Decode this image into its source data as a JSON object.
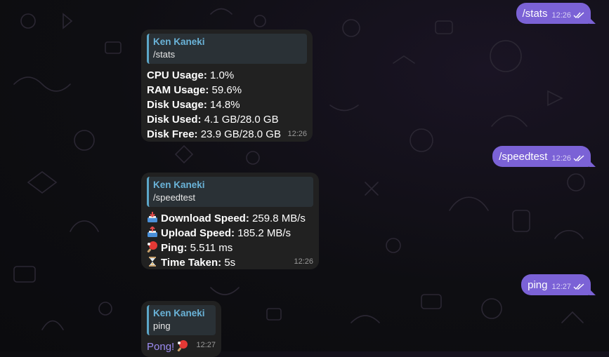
{
  "chat": {
    "outgoing": [
      {
        "text": "/stats",
        "time": "12:26",
        "status": "read"
      },
      {
        "text": "/speedtest",
        "time": "12:26",
        "status": "read"
      },
      {
        "text": "ping",
        "time": "12:27",
        "status": "read"
      }
    ],
    "stats_reply": {
      "reply_to_name": "Ken Kaneki",
      "reply_to_text": "/stats",
      "lines": [
        {
          "label": "CPU Usage:",
          "value": "1.0%"
        },
        {
          "label": "RAM Usage:",
          "value": "59.6%"
        },
        {
          "label": "Disk Usage:",
          "value": "14.8%"
        },
        {
          "label": "Disk Used:",
          "value": "4.1 GB/28.0 GB"
        },
        {
          "label": "Disk Free:",
          "value": "23.9 GB/28.0 GB"
        }
      ],
      "time": "12:26"
    },
    "speedtest_reply": {
      "reply_to_name": "Ken Kaneki",
      "reply_to_text": "/speedtest",
      "lines": [
        {
          "icon": "inbox-tray-icon",
          "label": "Download Speed:",
          "value": "259.8 MB/s"
        },
        {
          "icon": "outbox-tray-icon",
          "label": "Upload Speed:",
          "value": "185.2 MB/s"
        },
        {
          "icon": "ping-pong-icon",
          "label": "Ping:",
          "value": "5.511 ms"
        },
        {
          "icon": "hourglass-icon",
          "label": "Time Taken:",
          "value": "5s"
        }
      ],
      "time": "12:26"
    },
    "ping_reply": {
      "reply_to_name": "Ken Kaneki",
      "reply_to_text": "ping",
      "text": "Pong!",
      "icon": "ping-pong-icon",
      "time": "12:27"
    }
  },
  "colors": {
    "outgoing_bubble": "#7b62d6",
    "incoming_bubble": "#212121",
    "reply_accent": "#5ca7c9",
    "reply_name": "#6ab3d8",
    "pong_text": "#9d8cf2"
  }
}
